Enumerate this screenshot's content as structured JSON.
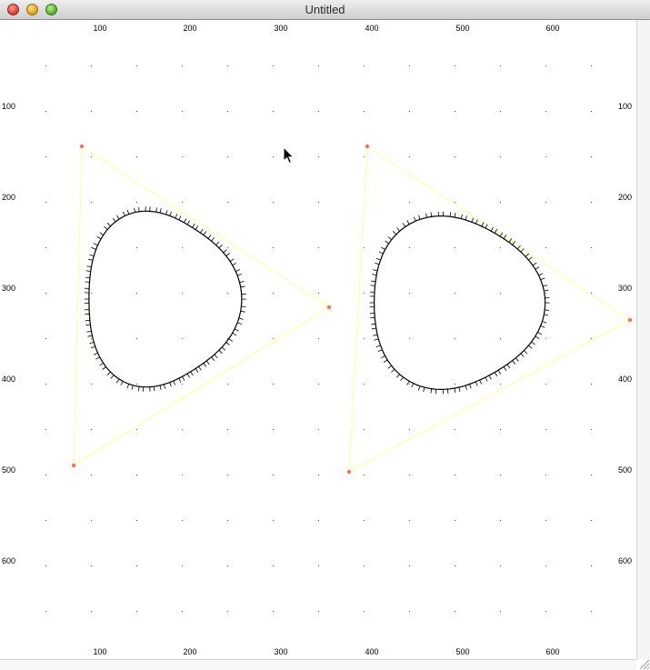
{
  "window": {
    "title": "Untitled"
  },
  "ruler": {
    "top_labels": [
      "100",
      "200",
      "300",
      "400",
      "500",
      "600"
    ],
    "bottom_labels": [
      "100",
      "200",
      "300",
      "400",
      "500",
      "600"
    ],
    "left_labels": [
      "100",
      "200",
      "300",
      "400",
      "500",
      "600"
    ],
    "right_labels": [
      "100",
      "200",
      "300",
      "400",
      "500",
      "600"
    ]
  },
  "colors": {
    "triangle_edge": "#ffff99",
    "control_point": "#ff6f5a",
    "curve": "#000000",
    "grid_dot": "#555555"
  },
  "icons": {
    "close": "close-button-icon",
    "minimize": "minimize-button-icon",
    "zoom": "zoom-button-icon",
    "cursor": "arrow-cursor-icon",
    "resize": "resize-grip-icon"
  }
}
